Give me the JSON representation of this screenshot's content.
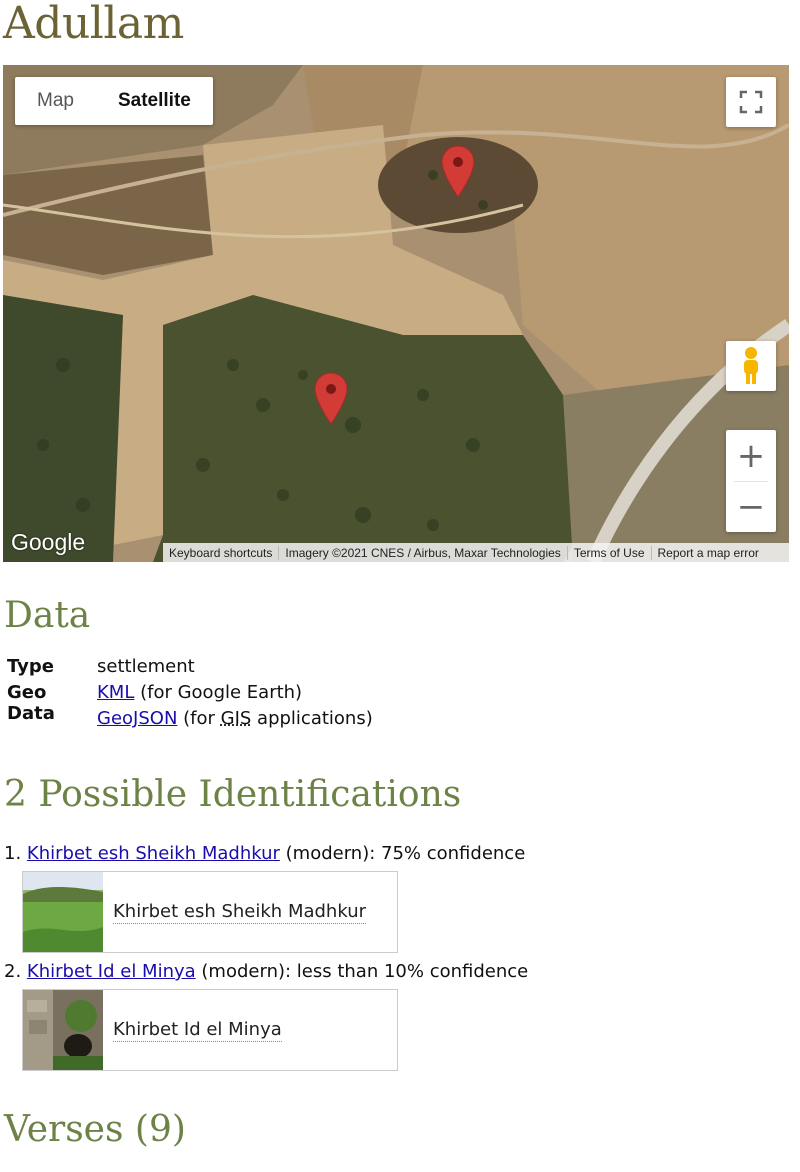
{
  "page": {
    "title": "Adullam"
  },
  "map": {
    "type_buttons": {
      "map": "Map",
      "satellite": "Satellite"
    },
    "controls": {
      "zoom_in": "+",
      "zoom_out": "−"
    },
    "logo": "Google",
    "attribution": {
      "shortcuts": "Keyboard shortcuts",
      "imagery": "Imagery ©2021 CNES / Airbus, Maxar Technologies",
      "terms": "Terms of Use",
      "report": "Report a map error"
    },
    "marker_color": "#d33b36"
  },
  "data_section": {
    "heading": "Data",
    "type_label": "Type",
    "type_value": "settlement",
    "geo_label": "Geo Data",
    "kml_link": "KML",
    "kml_note": " (for Google Earth)",
    "geojson_link": "GeoJSON",
    "geojson_note_pre": " (for ",
    "gis_abbr": "GIS",
    "geojson_note_post": " applications)"
  },
  "identifications": {
    "heading": "2 Possible Identifications",
    "items": [
      {
        "num": "1. ",
        "name": "Khirbet esh Sheikh Madhkur",
        "detail": " (modern): 75% confidence",
        "card_label": "Khirbet esh Sheikh Madhkur"
      },
      {
        "num": "2. ",
        "name": "Khirbet Id el Minya",
        "detail": " (modern): less than 10% confidence",
        "card_label": "Khirbet Id el Minya"
      }
    ]
  },
  "verses": {
    "heading": "Verses (9)"
  },
  "colors": {
    "title": "#6b6236",
    "heading": "#6c8246",
    "link": "#1a0dab"
  }
}
